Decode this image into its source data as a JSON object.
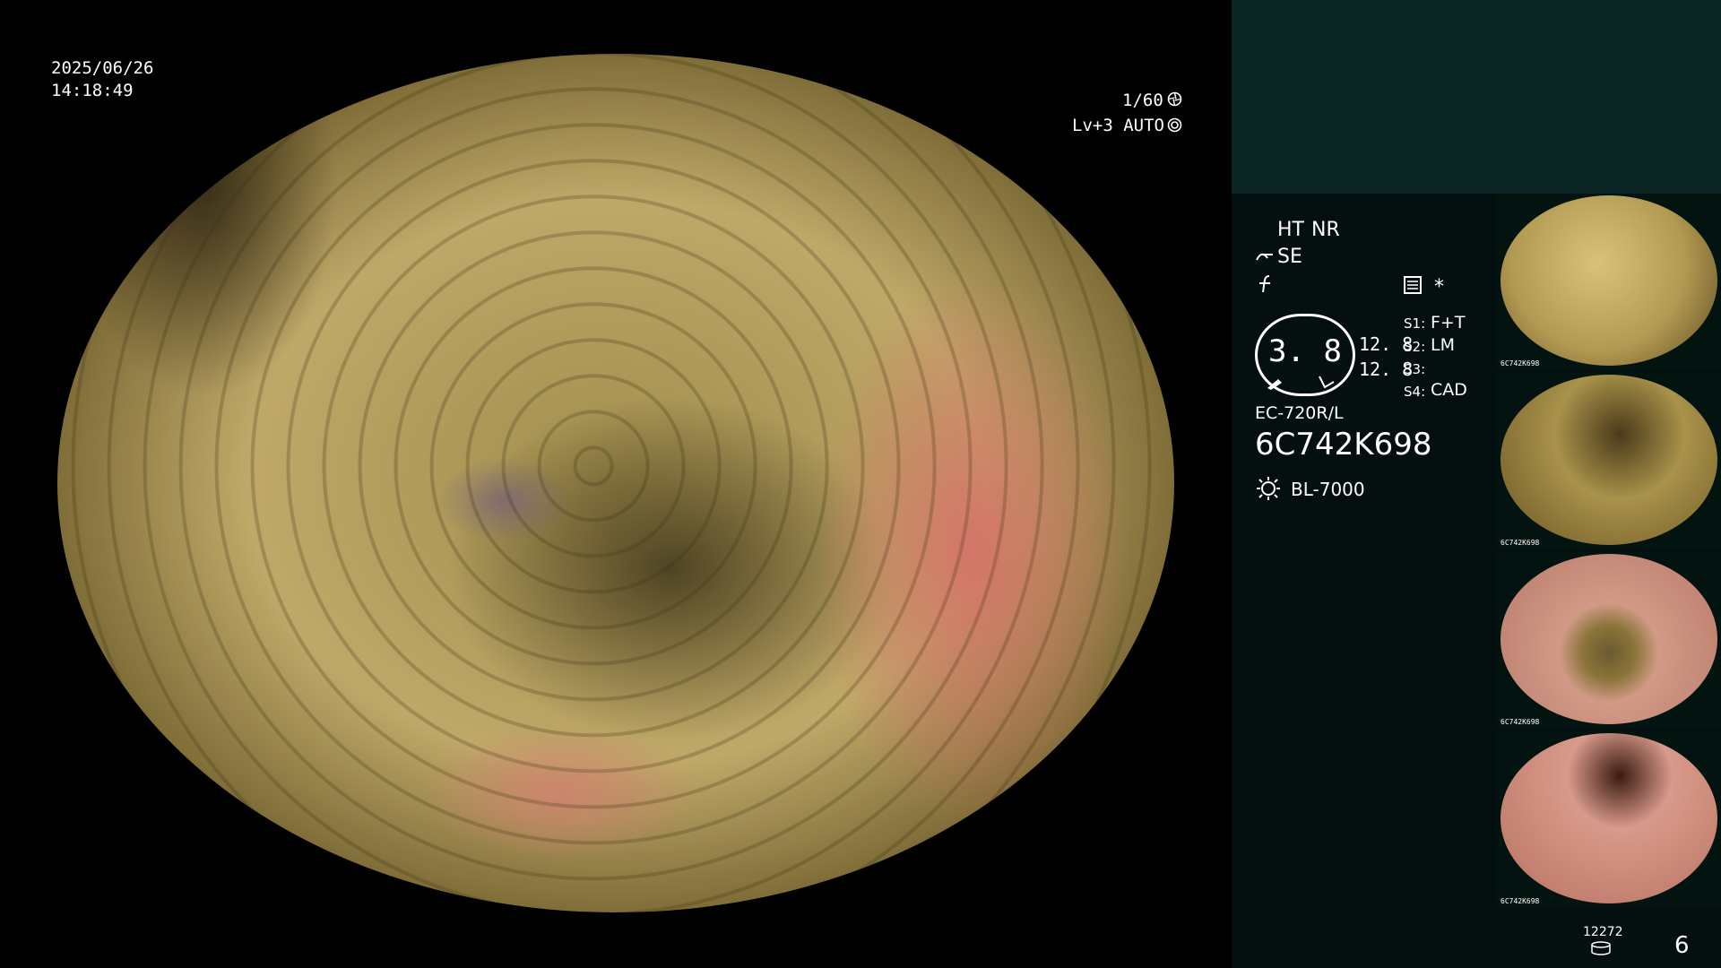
{
  "osd": {
    "date": "2025/06/26",
    "time": "14:18:49",
    "shutter": "1/60",
    "shutter_icon": "shutter-icon",
    "level": "Lv+3 AUTO",
    "auto_icon": "iris-icon"
  },
  "panel": {
    "ht": "HT",
    "nr": "NR",
    "se": "SE",
    "se_icon": "structure-enhance-icon",
    "f_icon": "filter-icon",
    "memo_icon": "memory-icon",
    "star": "*",
    "gauge_value": "3. 8",
    "val1": "12. 8",
    "val2": "12. 8",
    "s1_key": "S1:",
    "s1_val": "F+T",
    "s2_key": "S2:",
    "s2_val": "LM",
    "s3_key": "S3:",
    "s3_val": "",
    "s4_key": "S4:",
    "s4_val": "CAD",
    "scope_model": "EC-720R/L",
    "scope_serial": "6C742K698",
    "light_icon": "light-source-icon",
    "light_source": "BL-7000",
    "counter": "12272",
    "counter_icon": "storage-icon",
    "capture_count": "6"
  },
  "thumbnails": [
    {
      "label": "6C742K698",
      "tone": "#b39a52"
    },
    {
      "label": "6C742K698",
      "tone": "#a9924a"
    },
    {
      "label": "6C742K698",
      "tone": "#d19a86"
    },
    {
      "label": "6C742K698",
      "tone": "#d89a8a"
    }
  ],
  "colors": {
    "panel_bg": "#04100f",
    "panel_top": "#0b2525",
    "accent": "#f4b12d"
  }
}
